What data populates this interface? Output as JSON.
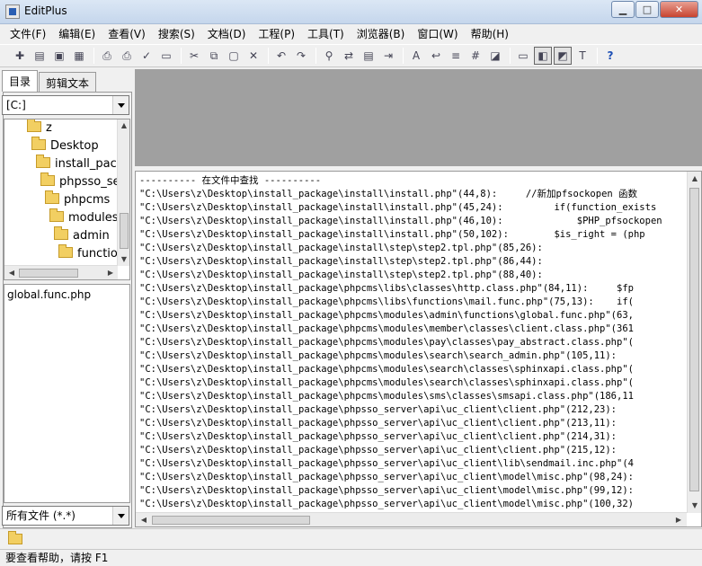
{
  "window": {
    "title": "EditPlus",
    "minimize_icon": "minimize-icon",
    "maximize_icon": "maximize-icon",
    "close_icon": "close-icon"
  },
  "menu": [
    "文件(F)",
    "编辑(E)",
    "查看(V)",
    "搜索(S)",
    "文档(D)",
    "工程(P)",
    "工具(T)",
    "浏览器(B)",
    "窗口(W)",
    "帮助(H)"
  ],
  "toolbar": {
    "buttons": [
      {
        "name": "new-file-icon",
        "glyph": "✚"
      },
      {
        "name": "open-folder-icon",
        "glyph": "▤"
      },
      {
        "name": "save-icon",
        "glyph": "▣"
      },
      {
        "name": "save-all-icon",
        "glyph": "▦"
      },
      {
        "name": "sep"
      },
      {
        "name": "print-preview-icon",
        "glyph": "⎙"
      },
      {
        "name": "print-icon",
        "glyph": "⎙"
      },
      {
        "name": "spell-check-icon",
        "glyph": "✓"
      },
      {
        "name": "document-icon",
        "glyph": "▭"
      },
      {
        "name": "sep"
      },
      {
        "name": "cut-icon",
        "glyph": "✂"
      },
      {
        "name": "copy-icon",
        "glyph": "⧉"
      },
      {
        "name": "paste-icon",
        "glyph": "▢"
      },
      {
        "name": "delete-icon",
        "glyph": "✕"
      },
      {
        "name": "sep"
      },
      {
        "name": "undo-icon",
        "glyph": "↶"
      },
      {
        "name": "redo-icon",
        "glyph": "↷"
      },
      {
        "name": "sep"
      },
      {
        "name": "find-icon",
        "glyph": "⚲"
      },
      {
        "name": "replace-icon",
        "glyph": "⇄"
      },
      {
        "name": "find-in-files-icon",
        "glyph": "▤"
      },
      {
        "name": "goto-icon",
        "glyph": "⇥"
      },
      {
        "name": "sep"
      },
      {
        "name": "font-icon",
        "glyph": "A"
      },
      {
        "name": "word-wrap-icon",
        "glyph": "↩"
      },
      {
        "name": "indent-icon",
        "glyph": "≡"
      },
      {
        "name": "line-number-icon",
        "glyph": "#"
      },
      {
        "name": "browser-icon",
        "glyph": "◪"
      },
      {
        "name": "sep"
      },
      {
        "name": "ruler-icon",
        "glyph": "▭"
      },
      {
        "name": "directory-window-icon",
        "glyph": "◧",
        "pressed": true
      },
      {
        "name": "output-window-icon",
        "glyph": "◩",
        "pressed": true
      },
      {
        "name": "cliptext-icon",
        "glyph": "T"
      },
      {
        "name": "sep"
      },
      {
        "name": "help-icon",
        "glyph": "?",
        "help": true
      }
    ]
  },
  "sidebar": {
    "tabs": [
      "目录",
      "剪辑文本"
    ],
    "drive": "[C:]",
    "tree": [
      "z",
      "Desktop",
      "install_package",
      "phpsso_server",
      "phpcms",
      "modules",
      "admin",
      "functions"
    ],
    "files": [
      "global.func.php"
    ],
    "filter": "所有文件 (*.*)"
  },
  "output": {
    "lines": [
      "---------- 在文件中查找 ----------",
      "\"C:\\Users\\z\\Desktop\\install_package\\install\\install.php\"(44,8):     //新加pfsockopen 函数",
      "\"C:\\Users\\z\\Desktop\\install_package\\install\\install.php\"(45,24):         if(function_exists",
      "\"C:\\Users\\z\\Desktop\\install_package\\install\\install.php\"(46,10):             $PHP_pfsockopen",
      "\"C:\\Users\\z\\Desktop\\install_package\\install\\install.php\"(50,102):        $is_right = (php",
      "\"C:\\Users\\z\\Desktop\\install_package\\install\\step\\step2.tpl.php\"(85,26):",
      "\"C:\\Users\\z\\Desktop\\install_package\\install\\step\\step2.tpl.php\"(86,44):",
      "\"C:\\Users\\z\\Desktop\\install_package\\install\\step\\step2.tpl.php\"(88,40):",
      "\"C:\\Users\\z\\Desktop\\install_package\\phpcms\\libs\\classes\\http.class.php\"(84,11):     $fp",
      "\"C:\\Users\\z\\Desktop\\install_package\\phpcms\\libs\\functions\\mail.func.php\"(75,13):    if(",
      "\"C:\\Users\\z\\Desktop\\install_package\\phpcms\\modules\\admin\\functions\\global.func.php\"(63,",
      "\"C:\\Users\\z\\Desktop\\install_package\\phpcms\\modules\\member\\classes\\client.class.php\"(361",
      "\"C:\\Users\\z\\Desktop\\install_package\\phpcms\\modules\\pay\\classes\\pay_abstract.class.php\"(",
      "\"C:\\Users\\z\\Desktop\\install_package\\phpcms\\modules\\search\\search_admin.php\"(105,11):",
      "\"C:\\Users\\z\\Desktop\\install_package\\phpcms\\modules\\search\\classes\\sphinxapi.class.php\"(",
      "\"C:\\Users\\z\\Desktop\\install_package\\phpcms\\modules\\search\\classes\\sphinxapi.class.php\"(",
      "\"C:\\Users\\z\\Desktop\\install_package\\phpcms\\modules\\sms\\classes\\smsapi.class.php\"(186,11",
      "\"C:\\Users\\z\\Desktop\\install_package\\phpsso_server\\api\\uc_client\\client.php\"(212,23):",
      "\"C:\\Users\\z\\Desktop\\install_package\\phpsso_server\\api\\uc_client\\client.php\"(213,11):",
      "\"C:\\Users\\z\\Desktop\\install_package\\phpsso_server\\api\\uc_client\\client.php\"(214,31):",
      "\"C:\\Users\\z\\Desktop\\install_package\\phpsso_server\\api\\uc_client\\client.php\"(215,12):",
      "\"C:\\Users\\z\\Desktop\\install_package\\phpsso_server\\api\\uc_client\\lib\\sendmail.inc.php\"(4",
      "\"C:\\Users\\z\\Desktop\\install_package\\phpsso_server\\api\\uc_client\\model\\misc.php\"(98,24):",
      "\"C:\\Users\\z\\Desktop\\install_package\\phpsso_server\\api\\uc_client\\model\\misc.php\"(99,12):",
      "\"C:\\Users\\z\\Desktop\\install_package\\phpsso_server\\api\\uc_client\\model\\misc.php\"(100,32)"
    ]
  },
  "status": {
    "text": "要查看帮助，请按 F1"
  }
}
